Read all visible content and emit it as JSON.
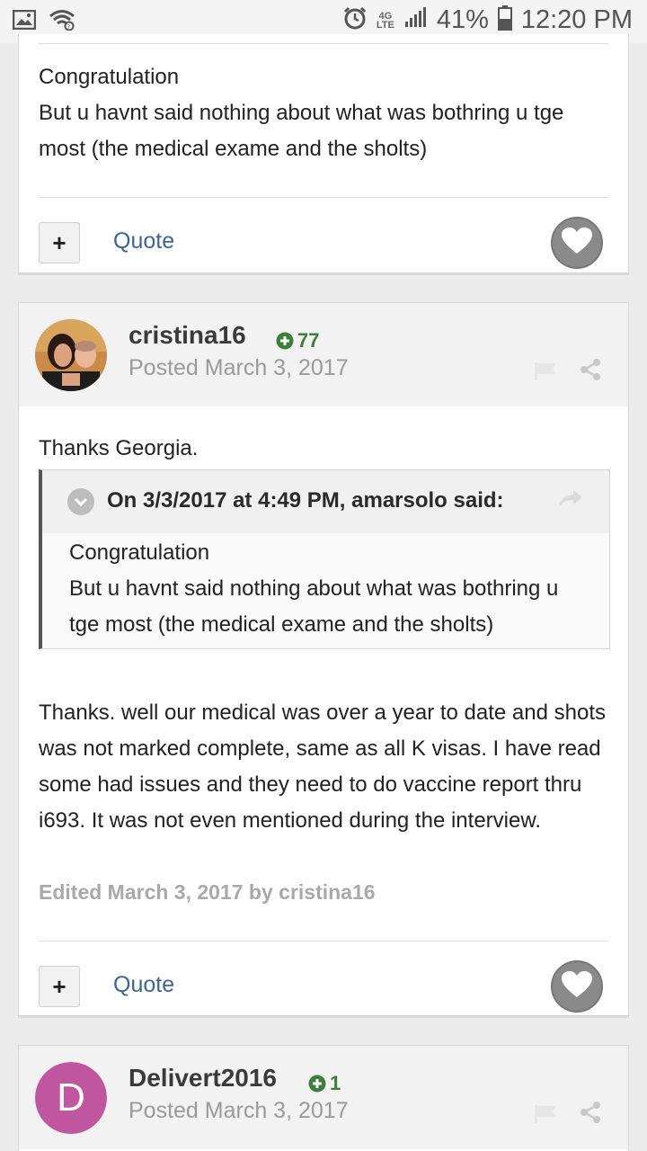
{
  "status_bar": {
    "network_type": "4G LTE",
    "battery": "41%",
    "time": "12:20 PM"
  },
  "post1": {
    "body_lines": [
      "Congratulation",
      "But u havnt said nothing about what was bothring u tge most (the medical exame and the sholts)"
    ],
    "plus_label": "+",
    "quote_label": "Quote"
  },
  "post2": {
    "author": "cristina16",
    "reputation": "77",
    "posted": "Posted March 3, 2017",
    "intro": "Thanks Georgia.",
    "quote": {
      "cite": "On 3/3/2017 at 4:49 PM, amarsolo said:",
      "line1": "Congratulation",
      "line2": "But u havnt said nothing about what was bothring u tge most (the medical exame and the sholts)"
    },
    "reply": "Thanks. well our medical was over a year to date and shots was not marked complete, same as all K visas. I have read some had issues and they need to do vaccine report thru i693. It was not even mentioned during the interview.",
    "edited": "Edited March 3, 2017 by cristina16",
    "plus_label": "+",
    "quote_label": "Quote"
  },
  "post3": {
    "avatar_letter": "D",
    "avatar_color": "#c0569f",
    "author": "Delivert2016",
    "reputation": "1",
    "posted": "Posted March 3, 2017"
  }
}
